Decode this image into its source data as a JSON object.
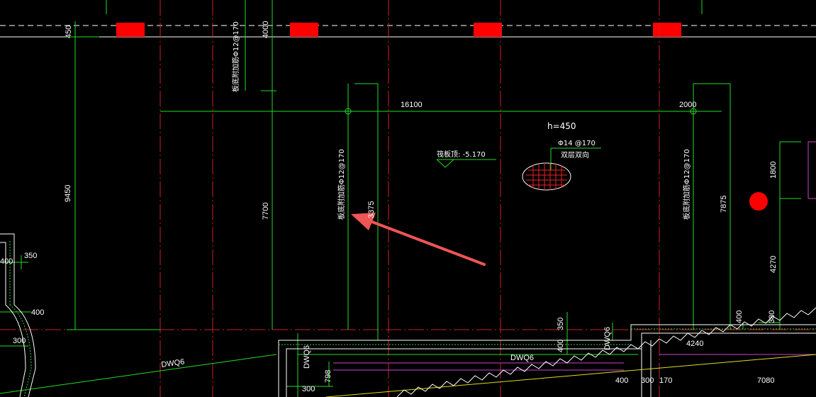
{
  "drawing": {
    "dimensions_top": [
      "450",
      "4000"
    ],
    "dim_16100": "16100",
    "dim_2000": "2000",
    "dim_9450": "9450",
    "dim_7700": "7700",
    "dim_7875": "7875",
    "dim_1800": "1800",
    "dim_4270": "4270",
    "dim_3375": "3375",
    "dim_350_left": "350",
    "dim_400_left_a": "400",
    "dim_400_left_b": "400",
    "dim_300_left": "300",
    "dim_350_mid": "350",
    "dim_400_mid": "400",
    "dim_400_right": "400",
    "dim_380_right": "380",
    "dim_4240": "4240",
    "dim_7080": "7080",
    "dim_798": "798",
    "dim_300_bottom": "300",
    "dim_400_bottom": "400",
    "dim_300_bottom_b": "300",
    "dim_170": "170",
    "label_h": "h=450",
    "label_rebar": "Φ14 @170",
    "label_double": "双层双向",
    "label_slab_top": "筏板顶: -5.170",
    "label_dwq6_a": "DWQ6",
    "label_dwq6_b": "DWQ6",
    "label_dwq6_c": "DWQ6",
    "label_dwq6_d": "DWQ6",
    "label_dwq6_e": "DWQ6",
    "vertical_note": "板底附加筋Φ12@170"
  },
  "colors": {
    "background": "#000000",
    "dimension": "#22dd22",
    "axis": "#cc2222",
    "column": "#ff0000",
    "arrow": "#ee5555",
    "wall_line": "#ffffff",
    "purple": "#cc44cc",
    "yellow": "#dddd22"
  }
}
